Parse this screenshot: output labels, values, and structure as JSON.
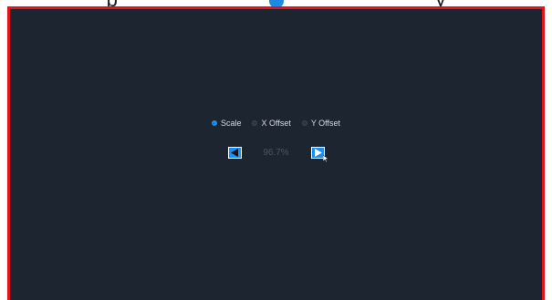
{
  "top_caption": {
    "left_text": "p",
    "right_text": "y"
  },
  "display_adjust": {
    "options": [
      {
        "label": "Scale",
        "selected": true
      },
      {
        "label": "X Offset",
        "selected": false
      },
      {
        "label": "Y Offset",
        "selected": false
      }
    ],
    "value": "96.7%",
    "icons": {
      "decrease": "arrow-left-icon",
      "increase": "arrow-right-icon",
      "cursor": "mouse-pointer-icon"
    }
  },
  "colors": {
    "frame": "#e3131b",
    "screen_bg": "#1d2530",
    "accent": "#1e8ef0"
  }
}
